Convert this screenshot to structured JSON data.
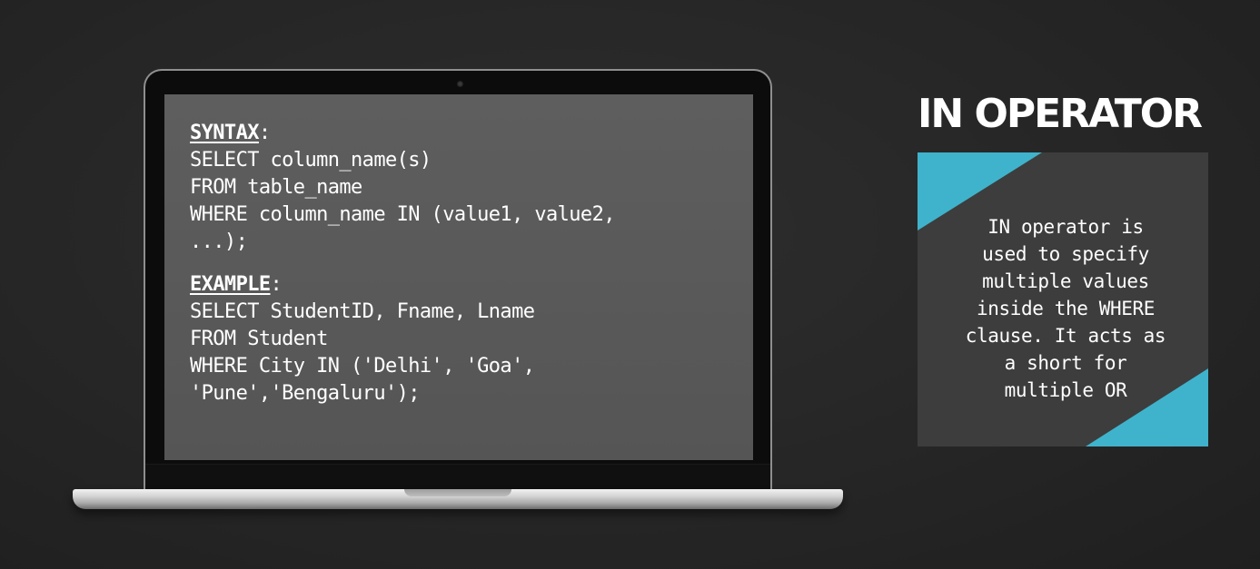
{
  "screen": {
    "syntax_heading": "SYNTAX",
    "syntax_colon": ":",
    "syntax_lines": [
      "SELECT column_name(s)",
      "FROM table_name",
      "WHERE column_name IN (value1, value2,",
      "...);"
    ],
    "example_heading": "EXAMPLE",
    "example_colon": ":",
    "example_lines": [
      "SELECT StudentID, Fname, Lname",
      "FROM Student",
      "WHERE City IN ('Delhi', 'Goa',",
      "'Pune','Bengaluru');"
    ]
  },
  "panel": {
    "title": "IN OPERATOR",
    "description_lines": [
      "IN operator is",
      "used to specify",
      "multiple values",
      "inside the WHERE",
      "clause. It acts as",
      "a short for",
      "multiple OR"
    ],
    "accent_color": "#3fb3cc"
  }
}
